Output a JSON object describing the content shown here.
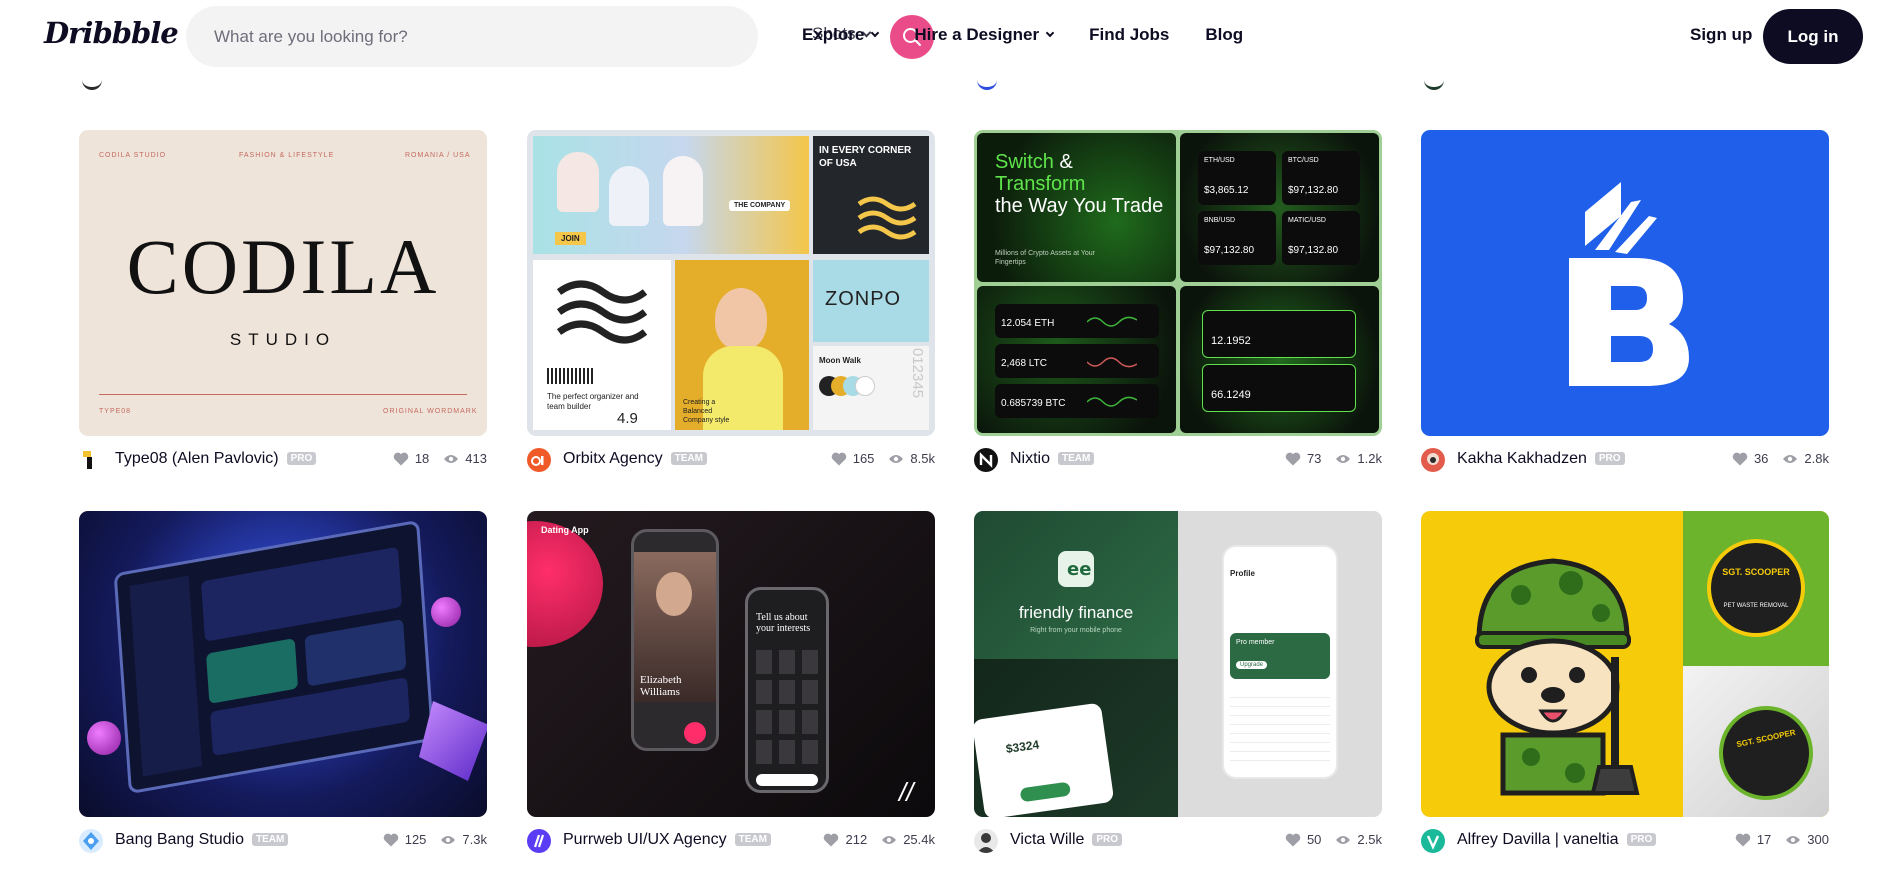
{
  "header": {
    "logo": "Dribbble",
    "search_placeholder": "What are you looking for?",
    "search_scope": "Shots",
    "nav": [
      "Explore",
      "Hire a Designer",
      "Find Jobs",
      "Blog"
    ],
    "signup": "Sign up",
    "login": "Log in"
  },
  "shots": [
    {
      "author": "Type08 (Alen Pavlovic)",
      "badge": "PRO",
      "likes": "18",
      "views": "413",
      "thumb_text": {
        "top_left": "CODILA STUDIO",
        "top_mid": "FASHION & LIFESTYLE",
        "top_right": "ROMANIA / USA",
        "title": "CODILA",
        "subtitle": "STUDIO",
        "bottom_left": "TYPE08",
        "bottom_right": "ORIGINAL WORDMARK"
      }
    },
    {
      "author": "Orbitx Agency",
      "badge": "TEAM",
      "likes": "165",
      "views": "8.5k",
      "thumb_text": {
        "corner": "IN EVERY CORNER OF USA",
        "company": "THE COMPANY",
        "join": "JOIN",
        "brand": "ZONPO",
        "organizer": "The perfect organizer and team builder",
        "rating": "4.9",
        "creating": "Creating a Balanced Company style",
        "moon": "Moon Walk",
        "digits": "012345"
      }
    },
    {
      "author": "Nixtio",
      "badge": "TEAM",
      "likes": "73",
      "views": "1.2k",
      "thumb_text": {
        "headline_1": "Switch",
        "headline_2": "& ",
        "headline_3": "Transform",
        "headline_4": "the Way You Trade",
        "tagline": "Millions of Crypto Assets at Your Fingertips",
        "eth_pair": "ETH/USD",
        "eth_val": "$3,865.12",
        "btc_pair": "BTC/USD",
        "btc_val": "$97,132.80",
        "bnb_pair": "BNB/USD",
        "bnb_val": "$97,132.80",
        "matic_pair": "MATIC/USD",
        "matic_val": "$97,132.80",
        "row1": "12.054 ETH",
        "row2": "2,468 LTC",
        "row3": "0.685739 BTC",
        "swap1": "12.1952",
        "swap2": "66.1249"
      }
    },
    {
      "author": "Kakha Kakhadzen",
      "badge": "PRO",
      "likes": "36",
      "views": "2.8k",
      "thumb_text": {}
    },
    {
      "author": "Bang Bang Studio",
      "badge": "TEAM",
      "likes": "125",
      "views": "7.3k",
      "thumb_text": {}
    },
    {
      "author": "Purrweb UI/UX Agency",
      "badge": "TEAM",
      "likes": "212",
      "views": "25.4k",
      "thumb_text": {
        "label": "Dating App",
        "name": "Elizabeth Williams",
        "interests": "Tell us about your interests"
      }
    },
    {
      "author": "Victa Wille",
      "badge": "PRO",
      "likes": "50",
      "views": "2.5k",
      "thumb_text": {
        "title": "friendly finance",
        "sub": "Right from your mobile phone",
        "amount": "$3324",
        "profile": "Profile",
        "pro": "Pro member",
        "upgrade": "Upgrade"
      }
    },
    {
      "author": "Alfrey Davilla | vaneltia",
      "badge": "PRO",
      "likes": "17",
      "views": "300",
      "thumb_text": {
        "sticker": "SGT. SCOOPER",
        "sticker_sub": "PET WASTE REMOVAL"
      }
    }
  ],
  "colors": {
    "accent": "#ea4c89",
    "text": "#0d0c22",
    "muted": "#6e6d7a",
    "badge": "#c8c8cf"
  },
  "icons": {
    "search": "search-icon",
    "like": "heart-icon",
    "views": "eye-icon",
    "chevron": "chevron-down-icon"
  }
}
